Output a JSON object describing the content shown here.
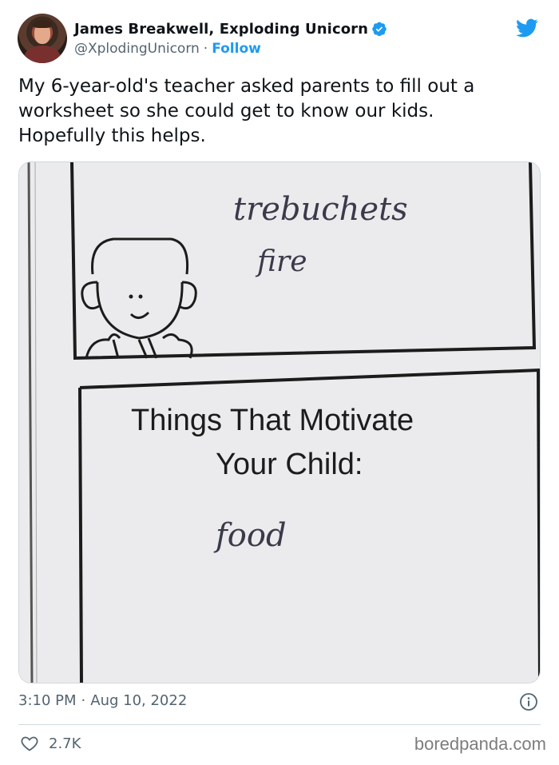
{
  "author": {
    "display_name": "James Breakwell, Exploding Unicorn",
    "handle": "@XplodingUnicorn",
    "separator": "·",
    "follow_label": "Follow",
    "verified": true,
    "avatar_icon": "profile-photo"
  },
  "platform_icon": "twitter-bird-icon",
  "accent_color": "#1d9bf0",
  "tweet": {
    "text_lines": [
      "My 6-year-old's teacher asked parents to fill out a",
      "worksheet so she could get to know our kids.",
      "Hopefully this helps."
    ]
  },
  "photo": {
    "handwritten_top": [
      "trebuchets",
      "fire"
    ],
    "printed_heading": [
      "Things That Motivate",
      "Your Child:"
    ],
    "handwritten_bottom": "food"
  },
  "meta": {
    "time": "3:10 PM",
    "separator": "·",
    "date": "Aug 10, 2022"
  },
  "actions": {
    "likes": "2.7K"
  },
  "watermark": "boredpanda.com"
}
